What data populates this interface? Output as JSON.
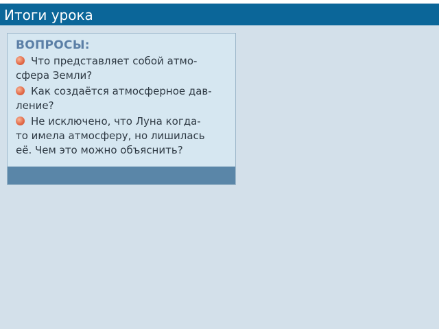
{
  "header": {
    "title": "Итоги урока"
  },
  "card": {
    "heading": "ВОПРОСЫ:",
    "lines": [
      "Что представляет собой атмо-",
      "сфера Земли?",
      "Как создаётся атмосферное дав-",
      "ление?",
      "Не исключено, что Луна когда-",
      "то имела атмосферу, но лишилась",
      "её. Чем это можно объяснить?"
    ],
    "bullet_icon": "orange-ball-icon",
    "bullet_color": "#e46d4b"
  },
  "colors": {
    "background": "#d3e0ea",
    "title_bar": "#0b6699",
    "card_footer": "#5a86a8",
    "heading": "#5b7fa6"
  }
}
